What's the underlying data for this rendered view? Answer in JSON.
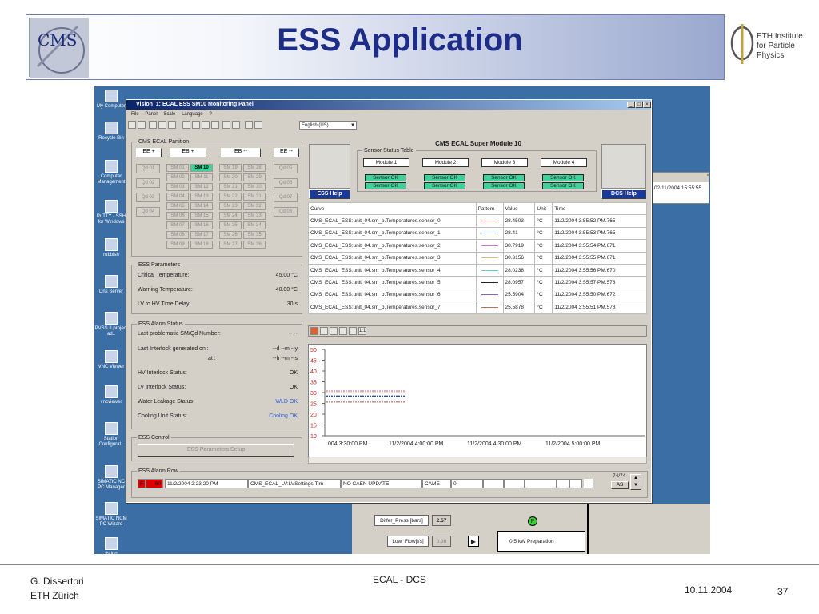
{
  "slide": {
    "title": "ESS Application",
    "eth_logo_text": "ETH Institute for Particle Physics",
    "footer": {
      "author": "G. Dissertori",
      "affiliation": "ETH Zürich",
      "center": "ECAL - DCS",
      "date": "10.11.2004",
      "page": "37"
    }
  },
  "desktop": {
    "icons": [
      "My Computer",
      "Recycle Bin",
      "Computer Management",
      "PuTTY - SSH for Windows",
      "rubbish",
      "Dns Server",
      "PVSS II project ad..",
      "VNC Viewer",
      "vncviewer",
      "Station Configurat..",
      "SIMATIC NC PC Manager",
      "SIMATIC NCM PC Wizard",
      "listing alarme.xls"
    ],
    "back_time": "02/11/2004 15:55:55",
    "back_labels": {
      "differ_press": "Differ_Press [bars]",
      "differ_press_val": "2.57",
      "low_flow": "Low_Flow[l/s]",
      "low_flow_val": "0.00",
      "preparation": "0.5 kW Preparation",
      "p_label": "P"
    }
  },
  "window": {
    "title": "Vision_1: ECAL ESS SM10 Monitoring Panel",
    "menu": [
      "File",
      "Panel",
      "Scale",
      "Language",
      "?"
    ],
    "language": "English (US)",
    "partition": {
      "title": "CMS ECAL Partition",
      "buttons": [
        "EE +",
        "EB +",
        "EB --",
        "EE --"
      ],
      "qd_left": [
        "Qd 01",
        "Qd 02",
        "Qd 03",
        "Qd 04"
      ],
      "qd_right": [
        "Qd 05",
        "Qd 06",
        "Qd 07",
        "Qd 08"
      ],
      "sm_columns": [
        [
          "SM 01",
          "SM 02",
          "SM 03",
          "SM 04",
          "SM 05",
          "SM 06",
          "SM 07",
          "SM 08",
          "SM 09"
        ],
        [
          "SM 10",
          "SM 11",
          "SM 12",
          "SM 13",
          "SM 14",
          "SM 15",
          "SM 16",
          "SM 17",
          "SM 18"
        ],
        [
          "SM 19",
          "SM 20",
          "SM 21",
          "SM 22",
          "SM 23",
          "SM 24",
          "SM 25",
          "SM 26",
          "SM 27"
        ],
        [
          "SM 28",
          "SM 29",
          "SM 30",
          "SM 31",
          "SM 32",
          "SM 33",
          "SM 34",
          "SM 35",
          "SM 36"
        ]
      ],
      "selected": "SM 10"
    },
    "super_module": {
      "title": "CMS ECAL Super Module 10",
      "sensor_table_label": "Sensor Status Table",
      "modules": [
        "Module 1",
        "Module 2",
        "Module 3",
        "Module 4"
      ],
      "sensor_status": "Sensor OK",
      "ess_help": "ESS Help",
      "dcs_help": "DCS Help"
    },
    "curves": {
      "headers": [
        "Curve",
        "Pattern",
        "Value",
        "Unit",
        "Time"
      ],
      "rows": [
        {
          "name": "CMS_ECAL_ESS:unit_04.sm_b.Temperatures.sensor_0",
          "color": "#e05050",
          "value": "28.4503",
          "unit": "°C",
          "time": "11/2/2004 3:55:52 PM.765"
        },
        {
          "name": "CMS_ECAL_ESS:unit_04.sm_b.Temperatures.sensor_1",
          "color": "#3a5fd0",
          "value": "28.41",
          "unit": "°C",
          "time": "11/2/2004 3:55:53 PM.765"
        },
        {
          "name": "CMS_ECAL_ESS:unit_04.sm_b.Temperatures.sensor_2",
          "color": "#d070d0",
          "value": "30.7919",
          "unit": "°C",
          "time": "11/2/2004 3:55:54 PM.671"
        },
        {
          "name": "CMS_ECAL_ESS:unit_04.sm_b.Temperatures.sensor_3",
          "color": "#e0c070",
          "value": "30.3156",
          "unit": "°C",
          "time": "11/2/2004 3:55:55 PM.671"
        },
        {
          "name": "CMS_ECAL_ESS:unit_04.sm_b.Temperatures.sensor_4",
          "color": "#60d0d0",
          "value": "28.0238",
          "unit": "°C",
          "time": "11/2/2004 3:55:56 PM.670"
        },
        {
          "name": "CMS_ECAL_ESS:unit_04.sm_b.Temperatures.sensor_5",
          "color": "#222222",
          "value": "28.0957",
          "unit": "°C",
          "time": "11/2/2004 3:55:57 PM.578"
        },
        {
          "name": "CMS_ECAL_ESS:unit_04.sm_b.Temperatures.sensor_6",
          "color": "#9060c0",
          "value": "25.5904",
          "unit": "°C",
          "time": "11/2/2004 3:55:50 PM.672"
        },
        {
          "name": "CMS_ECAL_ESS:unit_04.sm_b.Temperatures.sensor_7",
          "color": "#c07050",
          "value": "25.5878",
          "unit": "°C",
          "time": "11/2/2004 3:55:51 PM.578"
        }
      ]
    },
    "trend": {
      "y_ticks": [
        "50",
        "45",
        "40",
        "35",
        "30",
        "25",
        "20",
        "15",
        "10"
      ],
      "x_ticks": [
        "004 3:30:00 PM",
        "11/2/2004 4:00:00 PM",
        "11/2/2004 4:30:00 PM",
        "11/2/2004 5:00:00 PM"
      ],
      "toolbar_zoom": "1:1"
    },
    "params": {
      "title": "ESS Parameters",
      "rows": [
        {
          "label": "Critical Temperature:",
          "value": "45.00 °C"
        },
        {
          "label": "Warning Temperature:",
          "value": "40.00 °C"
        },
        {
          "label": "LV to HV Time Delay:",
          "value": "30 s"
        }
      ]
    },
    "alarm_status": {
      "title": "ESS Alarm Status",
      "last_sm": {
        "label": "Last problematic SM/Qd Number:",
        "value": "-- --"
      },
      "last_interlock": {
        "label": "Last Interlock generated on :",
        "date": "--d --m --y",
        "at": "at :",
        "time": "--h --m --s"
      },
      "rows": [
        {
          "label": "HV Interlock Status:",
          "value": "OK",
          "color": "#222"
        },
        {
          "label": "LV Interlock Status:",
          "value": "OK",
          "color": "#222"
        },
        {
          "label": "Water Leakage Status",
          "value": "WLD OK",
          "color": "#3060d0"
        },
        {
          "label": "Cooling Unit Status:",
          "value": "Cooling OK",
          "color": "#3060d0"
        }
      ]
    },
    "control": {
      "title": "ESS Control",
      "button": "ESS Parameters Setup"
    },
    "alarm_row": {
      "title": "ESS Alarm Row",
      "severity": "F",
      "code": "60",
      "time": "11/2/2004 2:23:20 PM",
      "dp": "CMS_ECAL_LV:LVSettings.Tim",
      "text": "NO CAEN UPDATE",
      "state": "CAME",
      "count": "0",
      "ellipsis": "...",
      "pager": "74/74",
      "as_label": "AS"
    }
  }
}
